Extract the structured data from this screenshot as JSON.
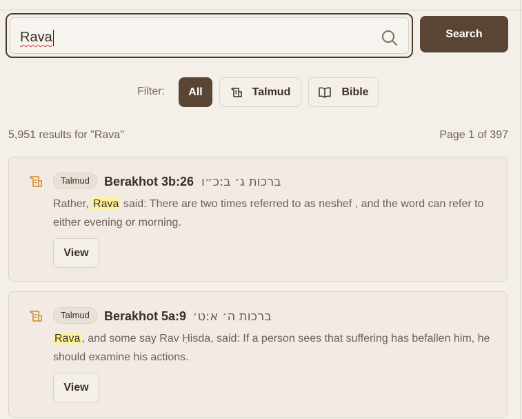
{
  "search": {
    "value": "Rava",
    "button_label": "Search"
  },
  "filter": {
    "label": "Filter:",
    "options": [
      {
        "label": "All",
        "active": true
      },
      {
        "label": "Talmud",
        "icon": "scroll-icon"
      },
      {
        "label": "Bible",
        "icon": "book-icon"
      }
    ]
  },
  "results": {
    "count_text": "5,951 results for \"Rava\"",
    "page_text": "Page 1 of 397",
    "items": [
      {
        "badge": "Talmud",
        "title": "Berakhot 3b:26",
        "hebrew": "ברכות ג׳ ב:כ״ו",
        "snippet_before": "Rather, ",
        "highlight": "Rava",
        "snippet_after": " said: There are two times referred to as neshef , and the word can refer to either evening or morning.",
        "view_label": "View"
      },
      {
        "badge": "Talmud",
        "title": "Berakhot 5a:9",
        "hebrew": "ברכות ה׳ א:ט׳",
        "snippet_before": "",
        "highlight": "Rava",
        "snippet_after": ", and some say Rav Ḥisda, said: If a person sees that suffering has befallen him, he should examine his actions.",
        "view_label": "View"
      }
    ]
  },
  "colors": {
    "background": "#f4efe8",
    "primary": "#5a4535",
    "icon_accent": "#d08a2a",
    "highlight": "#fff39a"
  }
}
